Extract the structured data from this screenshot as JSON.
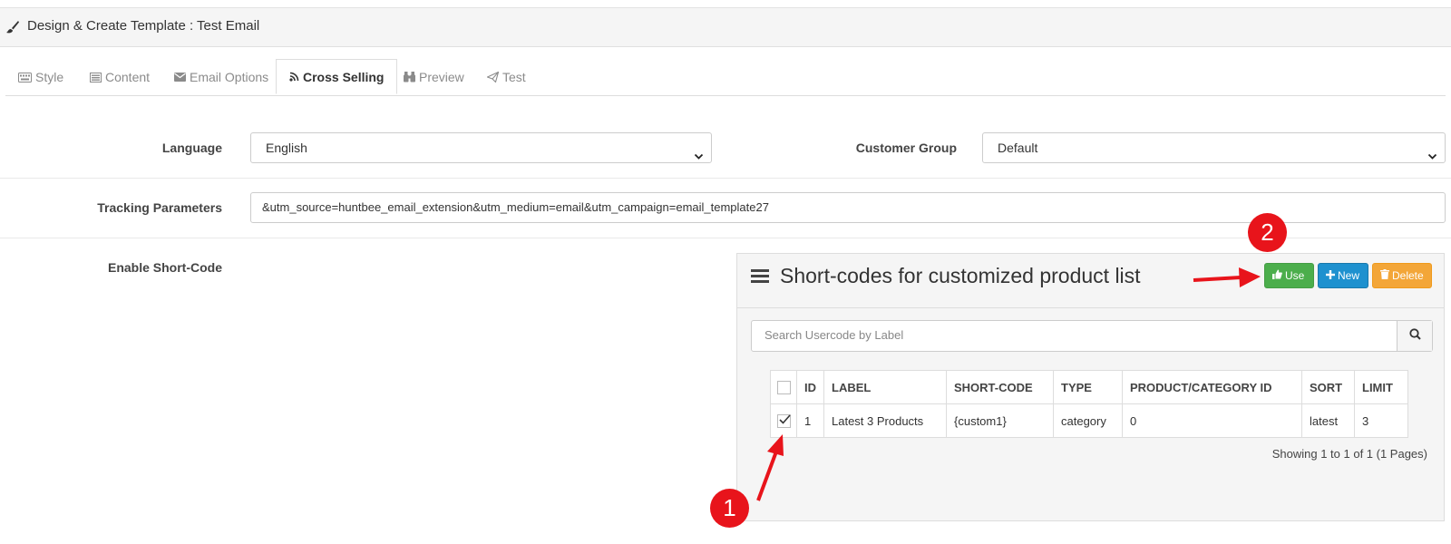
{
  "page": {
    "title": "Design & Create Template : Test Email",
    "brush_icon": "paint-brush-icon"
  },
  "tabs": [
    {
      "label": "Style",
      "icon": "keyboard-icon"
    },
    {
      "label": "Content",
      "icon": "list-alt-icon"
    },
    {
      "label": "Email Options",
      "icon": "envelope-icon"
    },
    {
      "label": "Cross Selling",
      "icon": "rss-icon",
      "active": true
    },
    {
      "label": "Preview",
      "icon": "binoculars-icon"
    },
    {
      "label": "Test",
      "icon": "paper-plane-icon"
    }
  ],
  "form": {
    "language_label": "Language",
    "language_value": "English",
    "customer_group_label": "Customer Group",
    "customer_group_value": "Default",
    "tracking_label": "Tracking Parameters",
    "tracking_value": "&utm_source=huntbee_email_extension&utm_medium=email&utm_campaign=email_template27",
    "shortcode_label": "Enable Short-Code"
  },
  "panel": {
    "title": "Short-codes for customized product list",
    "use_label": "Use",
    "new_label": "New",
    "delete_label": "Delete",
    "search_placeholder": "Search Usercode by Label",
    "columns": [
      "ID",
      "LABEL",
      "SHORT-CODE",
      "TYPE",
      "PRODUCT/CATEGORY ID",
      "SORT",
      "LIMIT"
    ],
    "rows": [
      {
        "checked": true,
        "id": "1",
        "label": "Latest 3 Products",
        "shortcode": "{custom1}",
        "type": "category",
        "product_category_id": "0",
        "sort": "latest",
        "limit": "3"
      }
    ],
    "pagination": "Showing 1 to 1 of 1 (1 Pages)"
  },
  "annotations": {
    "marker_1": "1",
    "marker_2": "2",
    "color": "#e8141b"
  },
  "colors": {
    "use_button": "#4cae4c",
    "new_button": "#1e91cf",
    "delete_button": "#f3a638"
  }
}
